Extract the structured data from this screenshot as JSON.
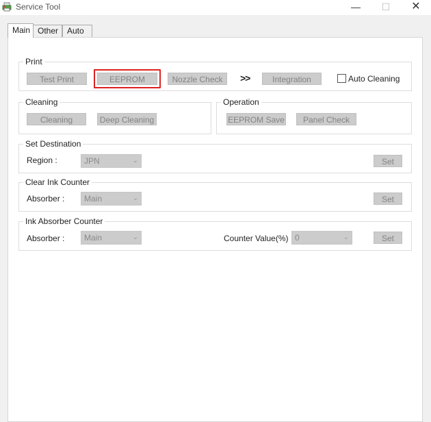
{
  "window": {
    "title": "Service Tool",
    "minimize_glyph": "—",
    "maximize_glyph": "☐",
    "close_glyph": "✕"
  },
  "tabs": [
    {
      "label": "Main",
      "active": true
    },
    {
      "label": "Other",
      "active": false
    },
    {
      "label": "Auto",
      "active": false
    }
  ],
  "print": {
    "legend": "Print",
    "test_print": "Test Print",
    "eeprom": "EEPROM",
    "nozzle_check": "Nozzle Check",
    "arrow": ">>",
    "integration": "Integration",
    "auto_cleaning": "Auto Cleaning"
  },
  "cleaning": {
    "legend": "Cleaning",
    "cleaning": "Cleaning",
    "deep_cleaning": "Deep Cleaning"
  },
  "operation": {
    "legend": "Operation",
    "eeprom_save": "EEPROM Save",
    "panel_check": "Panel Check"
  },
  "set_destination": {
    "legend": "Set Destination",
    "region_label": "Region :",
    "region_value": "JPN",
    "set": "Set"
  },
  "clear_ink_counter": {
    "legend": "Clear Ink Counter",
    "absorber_label": "Absorber :",
    "absorber_value": "Main",
    "set": "Set"
  },
  "ink_absorber_counter": {
    "legend": "Ink Absorber Counter",
    "absorber_label": "Absorber :",
    "absorber_value": "Main",
    "counter_label": "Counter Value(%) :",
    "counter_value": "0",
    "set": "Set"
  },
  "colors": {
    "highlight": "#d22222",
    "disabled_button": "#cccccc",
    "disabled_text": "#838383"
  }
}
